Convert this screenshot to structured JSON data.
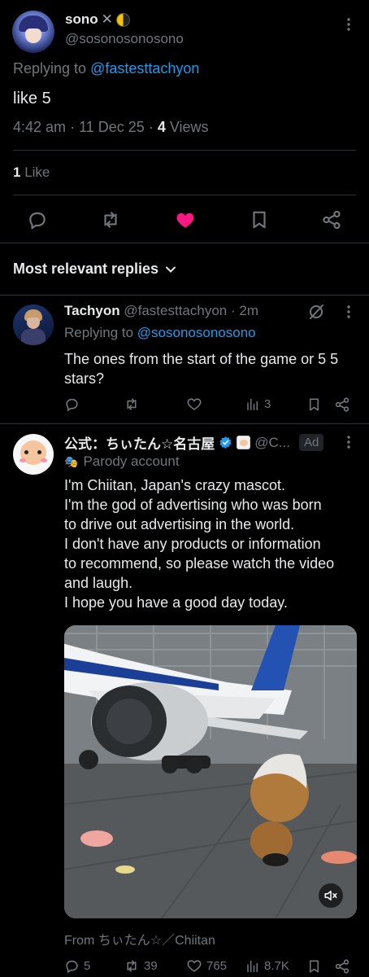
{
  "main_post": {
    "display_name": "sono",
    "handle": "@sosonosonosono",
    "replying_prefix": "Replying to",
    "replying_handle": "@fastesttachyon",
    "text": "like 5",
    "time": "4:42 am",
    "date": "11 Dec 25",
    "views_count": "4",
    "views_label": "Views",
    "likes_count": "1",
    "likes_label": "Like"
  },
  "replies_header": {
    "label": "Most relevant replies"
  },
  "reply1": {
    "display_name": "Tachyon",
    "handle": "@fastesttachyon",
    "time": "2m",
    "replying_prefix": "Replying to",
    "replying_handle": "@sosonosonosono",
    "text": "The ones from the start of the game or 5 5 stars?",
    "views": "3"
  },
  "ad": {
    "display_name": "公式：ちぃたん☆名古屋",
    "handle": "@C...",
    "ad_badge": "Ad",
    "parody_label": "Parody account",
    "text_lines": [
      "I'm Chiitan, Japan's crazy mascot.",
      "I'm the god of advertising who was born",
      "to drive out advertising in the world.",
      "I don't have any products or information",
      "to recommend, so please watch the video",
      "and laugh.",
      "I hope you have a good day today."
    ],
    "from_label": "From ちぃたん☆／Chiitan",
    "replies": "5",
    "reposts": "39",
    "likes": "765",
    "views": "8.7K"
  },
  "colors": {
    "accent": "#1d9bf0",
    "like": "#f91880",
    "muted": "#71767b",
    "text": "#e7e9ea"
  }
}
